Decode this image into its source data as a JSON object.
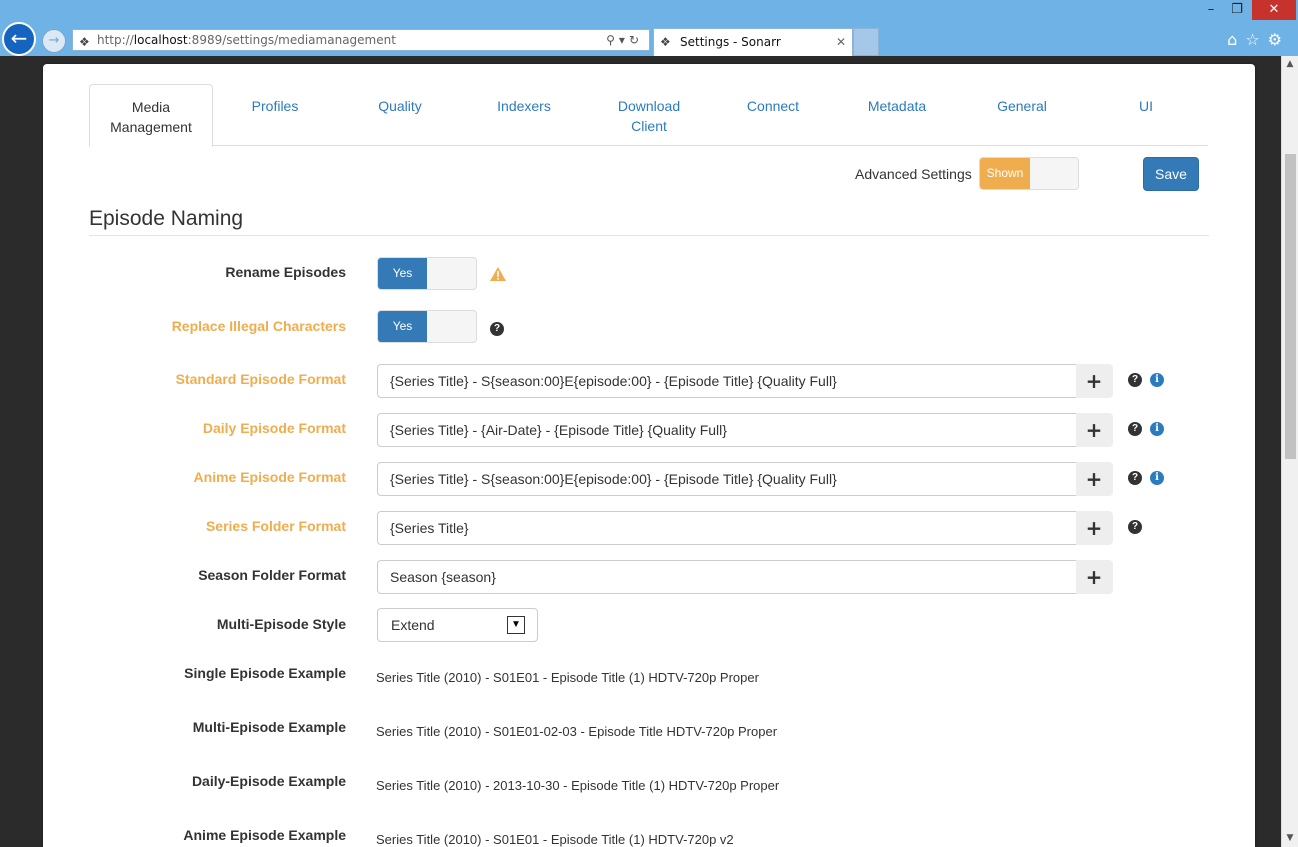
{
  "browser": {
    "url_prefix": "http://",
    "url_host": "localhost",
    "url_rest": ":8989/settings/mediamanagement",
    "tab_title": "Settings - Sonarr"
  },
  "tabs": [
    {
      "label": "Media Management",
      "active": true
    },
    {
      "label": "Profiles"
    },
    {
      "label": "Quality"
    },
    {
      "label": "Indexers"
    },
    {
      "label": "Download Client"
    },
    {
      "label": "Connect"
    },
    {
      "label": "Metadata"
    },
    {
      "label": "General"
    },
    {
      "label": "UI"
    }
  ],
  "advanced": {
    "label": "Advanced Settings",
    "toggle": "Shown"
  },
  "save_label": "Save",
  "section_title": "Episode Naming",
  "rename": {
    "label": "Rename Episodes",
    "value": "Yes"
  },
  "replace": {
    "label": "Replace Illegal Characters",
    "value": "Yes"
  },
  "formats": [
    {
      "label": "Standard Episode Format",
      "value": "{Series Title} - S{season:00}E{episode:00} - {Episode Title} {Quality Full}"
    },
    {
      "label": "Daily Episode Format",
      "value": "{Series Title} - {Air-Date} - {Episode Title} {Quality Full}"
    },
    {
      "label": "Anime Episode Format",
      "value": "{Series Title} - S{season:00}E{episode:00} - {Episode Title} {Quality Full}"
    },
    {
      "label": "Series Folder Format",
      "value": "{Series Title}"
    },
    {
      "label": "Season Folder Format",
      "value": "Season {season}"
    }
  ],
  "multi_episode": {
    "label": "Multi-Episode Style",
    "value": "Extend"
  },
  "examples": [
    {
      "label": "Single Episode Example",
      "value": "Series Title (2010) - S01E01 - Episode Title (1) HDTV-720p Proper"
    },
    {
      "label": "Multi-Episode Example",
      "value": "Series Title (2010) - S01E01-02-03 - Episode Title HDTV-720p Proper"
    },
    {
      "label": "Daily-Episode Example",
      "value": "Series Title (2010) - 2013-10-30 - Episode Title (1) HDTV-720p Proper"
    },
    {
      "label": "Anime Episode Example",
      "value": "Series Title (2010) - S01E01 - Episode Title (1) HDTV-720p v2"
    }
  ],
  "colors": {
    "accent": "#337ab7",
    "advanced": "#f0ad4e",
    "link": "#2b7bbf"
  }
}
